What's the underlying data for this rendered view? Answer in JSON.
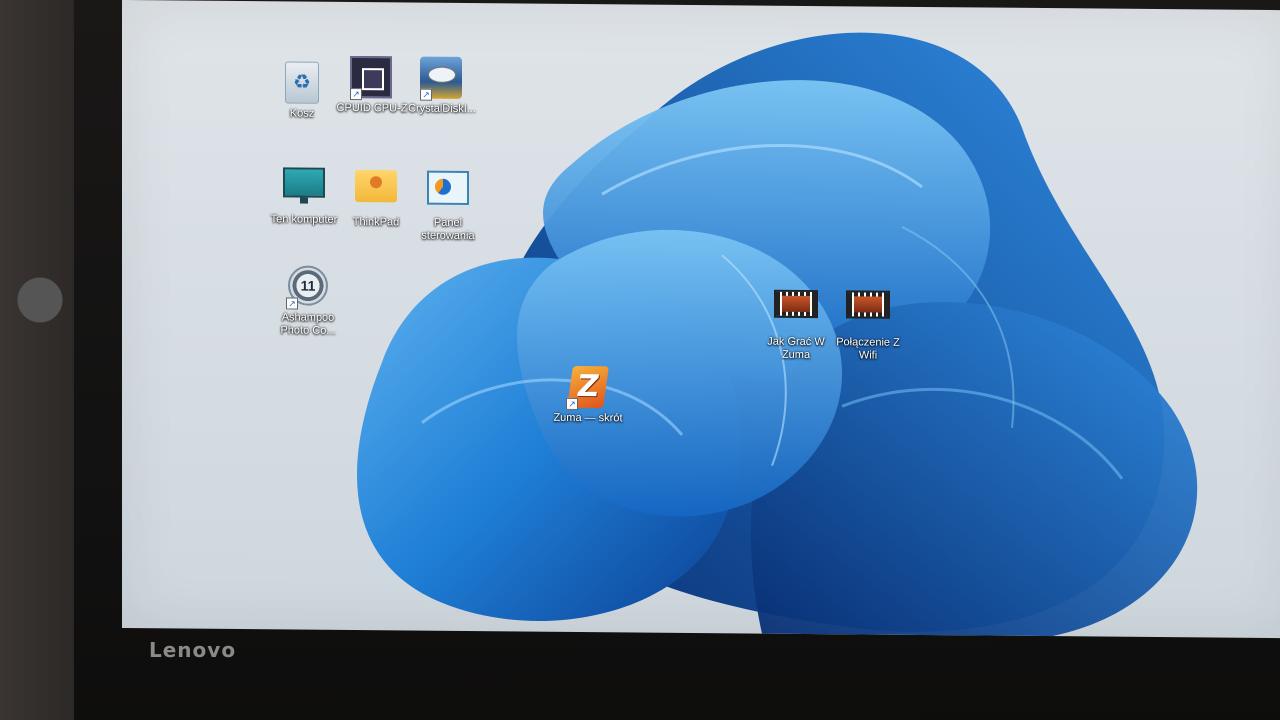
{
  "brand": "Lenovo",
  "desktop": {
    "icons": [
      {
        "id": "recycle-bin",
        "label": "Kosz",
        "icon": "recycle-bin-icon"
      },
      {
        "id": "cpuid",
        "label": "CPUID CPU-Z",
        "icon": "cpu-z-icon"
      },
      {
        "id": "crystaldisk",
        "label": "CrystalDiskI...",
        "icon": "crystaldisk-icon"
      },
      {
        "id": "this-pc",
        "label": "Ten komputer",
        "icon": "monitor-icon"
      },
      {
        "id": "thinkpad",
        "label": "ThinkPad",
        "icon": "user-folder-icon"
      },
      {
        "id": "control-panel",
        "label": "Panel sterowania",
        "icon": "control-panel-icon"
      },
      {
        "id": "ashampoo",
        "label": "Ashampoo Photo Co...",
        "icon": "ashampoo-icon"
      },
      {
        "id": "video-zuma",
        "label": "Jak Grać W Zuma",
        "icon": "video-file-icon"
      },
      {
        "id": "video-wifi",
        "label": "Połączenie Z Wifi",
        "icon": "video-file-icon"
      },
      {
        "id": "zuma",
        "label": "Zuma — skrót",
        "icon": "zuma-icon"
      }
    ]
  },
  "colors": {
    "wallpaper_background": "#d6dde3",
    "bloom_blue": "#1f7fd6",
    "bloom_dark": "#0b3f93"
  }
}
